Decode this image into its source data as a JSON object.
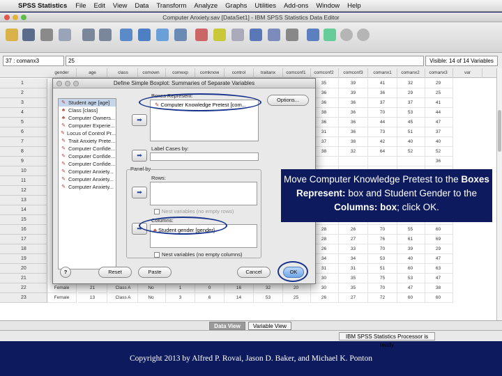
{
  "menubar": {
    "app_name": "SPSS Statistics",
    "items": [
      "File",
      "Edit",
      "View",
      "Data",
      "Transform",
      "Analyze",
      "Graphs",
      "Utilities",
      "Add-ons",
      "Window",
      "Help"
    ]
  },
  "window": {
    "title": "Computer Anxiety.sav [DataSet1] - IBM SPSS Statistics Data Editor",
    "cell_ref": "37 : comanx3",
    "cell_value": "25",
    "visible_vars": "Visible: 14 of 14 Variables"
  },
  "grid": {
    "columns": [
      "gender",
      "age",
      "class",
      "comown",
      "comexp",
      "comknow",
      "control",
      "traitanx",
      "comconf1",
      "comconf2",
      "comconf3",
      "comanx1",
      "comanx2",
      "comanx3",
      "var"
    ],
    "row_numbers": [
      "1",
      "2",
      "3",
      "4",
      "5",
      "6",
      "7",
      "8",
      "9",
      "10",
      "11",
      "12",
      "13",
      "14",
      "15",
      "16",
      "17",
      "18",
      "19",
      "20",
      "21",
      "22",
      "23"
    ],
    "right_values": [
      [
        "35",
        "39",
        "41",
        "32",
        "29"
      ],
      [
        "36",
        "39",
        "36",
        "29",
        "25"
      ],
      [
        "36",
        "36",
        "37",
        "37",
        "41"
      ],
      [
        "38",
        "36",
        "70",
        "53",
        "44"
      ],
      [
        "36",
        "36",
        "44",
        "45",
        "47"
      ],
      [
        "31",
        "36",
        "73",
        "51",
        "37"
      ],
      [
        "37",
        "38",
        "42",
        "40",
        "40"
      ],
      [
        "38",
        "32",
        "64",
        "52",
        "52"
      ],
      [
        "",
        "",
        "",
        "",
        "36"
      ],
      [
        "",
        "",
        "",
        "",
        ""
      ],
      [
        "",
        "",
        "",
        "",
        ""
      ],
      [
        "",
        "",
        "",
        "",
        ""
      ],
      [
        "",
        "",
        "",
        "",
        ""
      ],
      [
        "",
        "",
        "",
        "",
        ""
      ],
      [
        "",
        "",
        "",
        "",
        ""
      ],
      [
        "28",
        "26",
        "70",
        "55",
        "60"
      ],
      [
        "28",
        "27",
        "76",
        "61",
        "69"
      ],
      [
        "26",
        "33",
        "70",
        "39",
        "29"
      ],
      [
        "34",
        "34",
        "53",
        "40",
        "47"
      ],
      [
        "31",
        "31",
        "51",
        "60",
        "63"
      ],
      [
        "30",
        "35",
        "75",
        "53",
        "47"
      ],
      [
        "30",
        "35",
        "70",
        "47",
        "38"
      ],
      [
        "26",
        "27",
        "72",
        "60",
        "60"
      ]
    ],
    "bottom_rows": [
      [
        "Female",
        "21",
        "Class A",
        "No",
        "1",
        "0",
        "16",
        "32",
        "20"
      ],
      [
        "Female",
        "13",
        "Class A",
        "No",
        "3",
        "6",
        "14",
        "53",
        "25"
      ]
    ]
  },
  "tabs": {
    "data_view": "Data View",
    "variable_view": "Variable View"
  },
  "status": {
    "processor": "IBM SPSS Statistics Processor is ready"
  },
  "dialog": {
    "title": "Define Simple Boxplot: Summaries of Separate Variables",
    "variables": [
      {
        "icon": "scale-icon",
        "label": "Student age [age]"
      },
      {
        "icon": "nominal-icon",
        "label": "Class [class]"
      },
      {
        "icon": "nominal-icon",
        "label": "Computer Owners..."
      },
      {
        "icon": "scale-icon",
        "label": "Computer Experie..."
      },
      {
        "icon": "scale-icon",
        "label": "Locus of Control Pr..."
      },
      {
        "icon": "scale-icon",
        "label": "Trait Anxiety Prete..."
      },
      {
        "icon": "scale-icon",
        "label": "Computer Confide..."
      },
      {
        "icon": "scale-icon",
        "label": "Computer Confide..."
      },
      {
        "icon": "scale-icon",
        "label": "Computer Confide..."
      },
      {
        "icon": "scale-icon",
        "label": "Computer Anxiety..."
      },
      {
        "icon": "scale-icon",
        "label": "Computer Anxiety..."
      },
      {
        "icon": "scale-icon",
        "label": "Computer Anxiety..."
      }
    ],
    "boxes_represent_label": "Boxes Represent:",
    "boxes_represent_value": "Computer Knowledge Pretest [com...",
    "options_button": "Options...",
    "label_cases_label": "Label Cases by:",
    "panel_by_label": "Panel by",
    "rows_label": "Rows:",
    "nest_rows": "Nest variables (no empty rows)",
    "columns_label": "Columns:",
    "columns_value": "Student gender [gender]",
    "nest_columns": "Nest variables (no empty columns)",
    "help_button": "?",
    "reset_button": "Reset",
    "paste_button": "Paste",
    "cancel_button": "Cancel",
    "ok_button": "OK"
  },
  "callout": {
    "t1": "Move Computer Knowledge Pretest to the ",
    "b1": "Boxes Represent:",
    "t2": " box and Student Gender to the ",
    "b2": "Columns: box",
    "t3": "; click OK."
  },
  "footer": "Copyright 2013 by Alfred P. Rovai, Jason D. Baker, and Michael K. Ponton"
}
